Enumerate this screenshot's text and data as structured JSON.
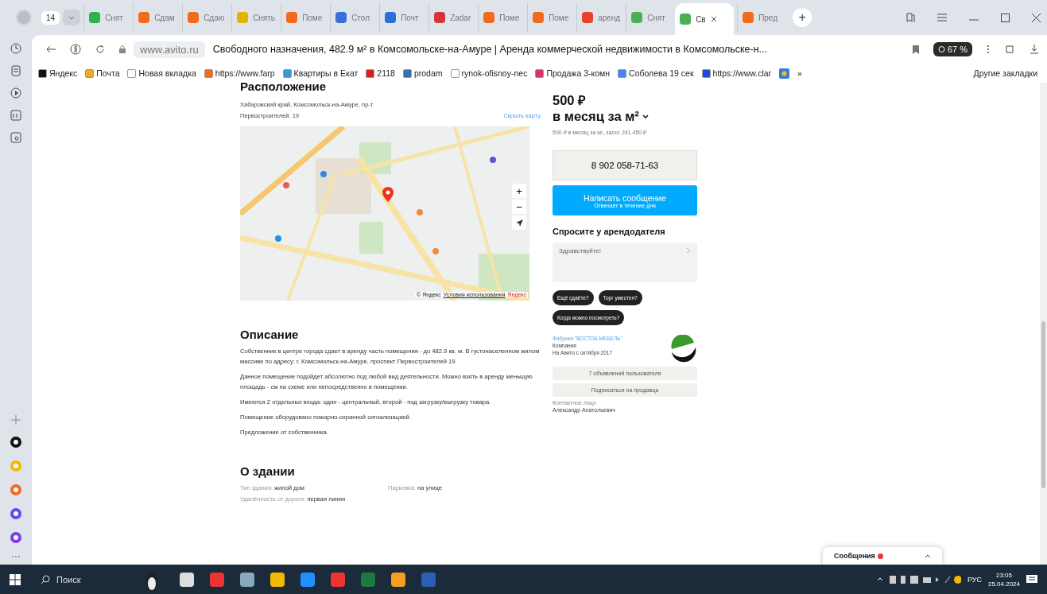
{
  "browser": {
    "tab_count": "14",
    "tabs": [
      {
        "title": "Снят",
        "color": "#2fb24c",
        "selected": false
      },
      {
        "title": "Сдам",
        "color": "#f26b1d",
        "selected": false
      },
      {
        "title": "Сдаю",
        "color": "#f26b1d",
        "selected": false
      },
      {
        "title": "Снять",
        "color": "#e0b400",
        "selected": false
      },
      {
        "title": "Поме",
        "color": "#f26b1d",
        "selected": false
      },
      {
        "title": "Стол",
        "color": "#3a6fd8",
        "selected": false
      },
      {
        "title": "Почт",
        "color": "#2a6fd6",
        "selected": false
      },
      {
        "title": "Zadar",
        "color": "#d6343a",
        "selected": false
      },
      {
        "title": "Поме",
        "color": "#f26b1d",
        "selected": false
      },
      {
        "title": "Поме",
        "color": "#f26b1d",
        "selected": false
      },
      {
        "title": "аренд",
        "color": "#e8412c",
        "selected": false
      },
      {
        "title": "Снят",
        "color": "#4caf50",
        "selected": false
      },
      {
        "title": "Св",
        "color": "#4caf50",
        "selected": true
      },
      {
        "title": "Пред",
        "color": "#f26b1d",
        "selected": false
      }
    ],
    "new_tab": "+",
    "address": {
      "domain": "www.avito.ru",
      "title": "Свободного назначения, 482.9 м² в Комсомольске-на-Амуре | Аренда коммерческой недвижимости в Комсомольске-н..."
    },
    "zoom_badge": "67 %",
    "bookmarks": [
      {
        "label": "Яндекс",
        "color": "#111111"
      },
      {
        "label": "Почта",
        "color": "#f5a623"
      },
      {
        "label": "Новая вкладка",
        "color": "#ffffff"
      },
      {
        "label": "https://www.farp",
        "color": "#f26b1d"
      },
      {
        "label": "Квартиры в Екат",
        "color": "#3a9ad9"
      },
      {
        "label": "2118",
        "color": "#d62020"
      },
      {
        "label": "prodam",
        "color": "#3a6fb0"
      },
      {
        "label": "rynok-ofisnoy-nec",
        "color": "#ffffff"
      },
      {
        "label": "Продажа 3-комн",
        "color": "#d6336c"
      },
      {
        "label": "Соболева 19 сек",
        "color": "#4285f4"
      },
      {
        "label": "https://www.clar",
        "color": "#1a4fd6"
      }
    ],
    "more_bookmarks": "»",
    "other_bookmarks": "Другие закладки"
  },
  "location": {
    "heading": "Расположение",
    "address": "Хабаровский край, Комсомольск-на-Амуре, пр-т Первостроителей, 19",
    "hide_map": "Скрыть карту",
    "map_controls": [
      "+",
      "−"
    ],
    "map_credit": "© Яндекс",
    "map_terms": "Условия использования",
    "map_brand": "Яндекс"
  },
  "description": {
    "heading": "Описание",
    "paragraphs": [
      "Собственник в центре города сдает в аренду часть помещения - до 482.9 кв. м. В густонаселенном жилом массиве по адресу: г. Комсомольск-на-Амуре, проспект Первостроителей 19.",
      "Данное помещение подойдет абсолютно под любой вид деятельности. Можно взять в аренду меньшую площадь - см на схеме или непосредственно в помещении.",
      "Имеются 2 отдельных входа: один - центральный, второй - под загрузку/выгрузку товара.",
      "Помещение оборудовано пожарно-охранной сигнализацией.",
      "Предложение от собственника."
    ]
  },
  "building": {
    "heading": "О здании",
    "params": [
      {
        "label": "Тип здания:",
        "value": "жилой дом"
      },
      {
        "label": "Парковка:",
        "value": "на улице"
      },
      {
        "label": "Удалённость от дороги:",
        "value": "первая линия"
      }
    ]
  },
  "offer": {
    "price": "500 ₽",
    "unit": "в месяц за м²",
    "details": "500 ₽ в месяц за м², залог 241 450 ₽",
    "phone": "8 902 058-71-63",
    "message_button": "Написать сообщение",
    "message_note": "Отвечает в течение дня",
    "ask_heading": "Спросите у арендодателя",
    "ask_value": "Здравствуйте!",
    "quick_questions": [
      "Ещё сдаёте?",
      "Торг уместен?",
      "Когда можно посмотреть?"
    ],
    "seller": {
      "name": "Фабрика \"ВОСТОК-МЕБЕЛЬ\"",
      "type": "Компания",
      "since": "На Авито с октября 2017",
      "listings": "7 объявлений пользователя",
      "subscribe": "Подписаться на продавца",
      "contact_label": "Контактное лицо",
      "contact_name": "Александр Анатольевич"
    }
  },
  "messages_popup": {
    "label": "Сообщения",
    "unread": true
  },
  "taskbar": {
    "search": "Поиск",
    "lang": "РУС",
    "time": "23:05",
    "date": "25.04.2024"
  }
}
